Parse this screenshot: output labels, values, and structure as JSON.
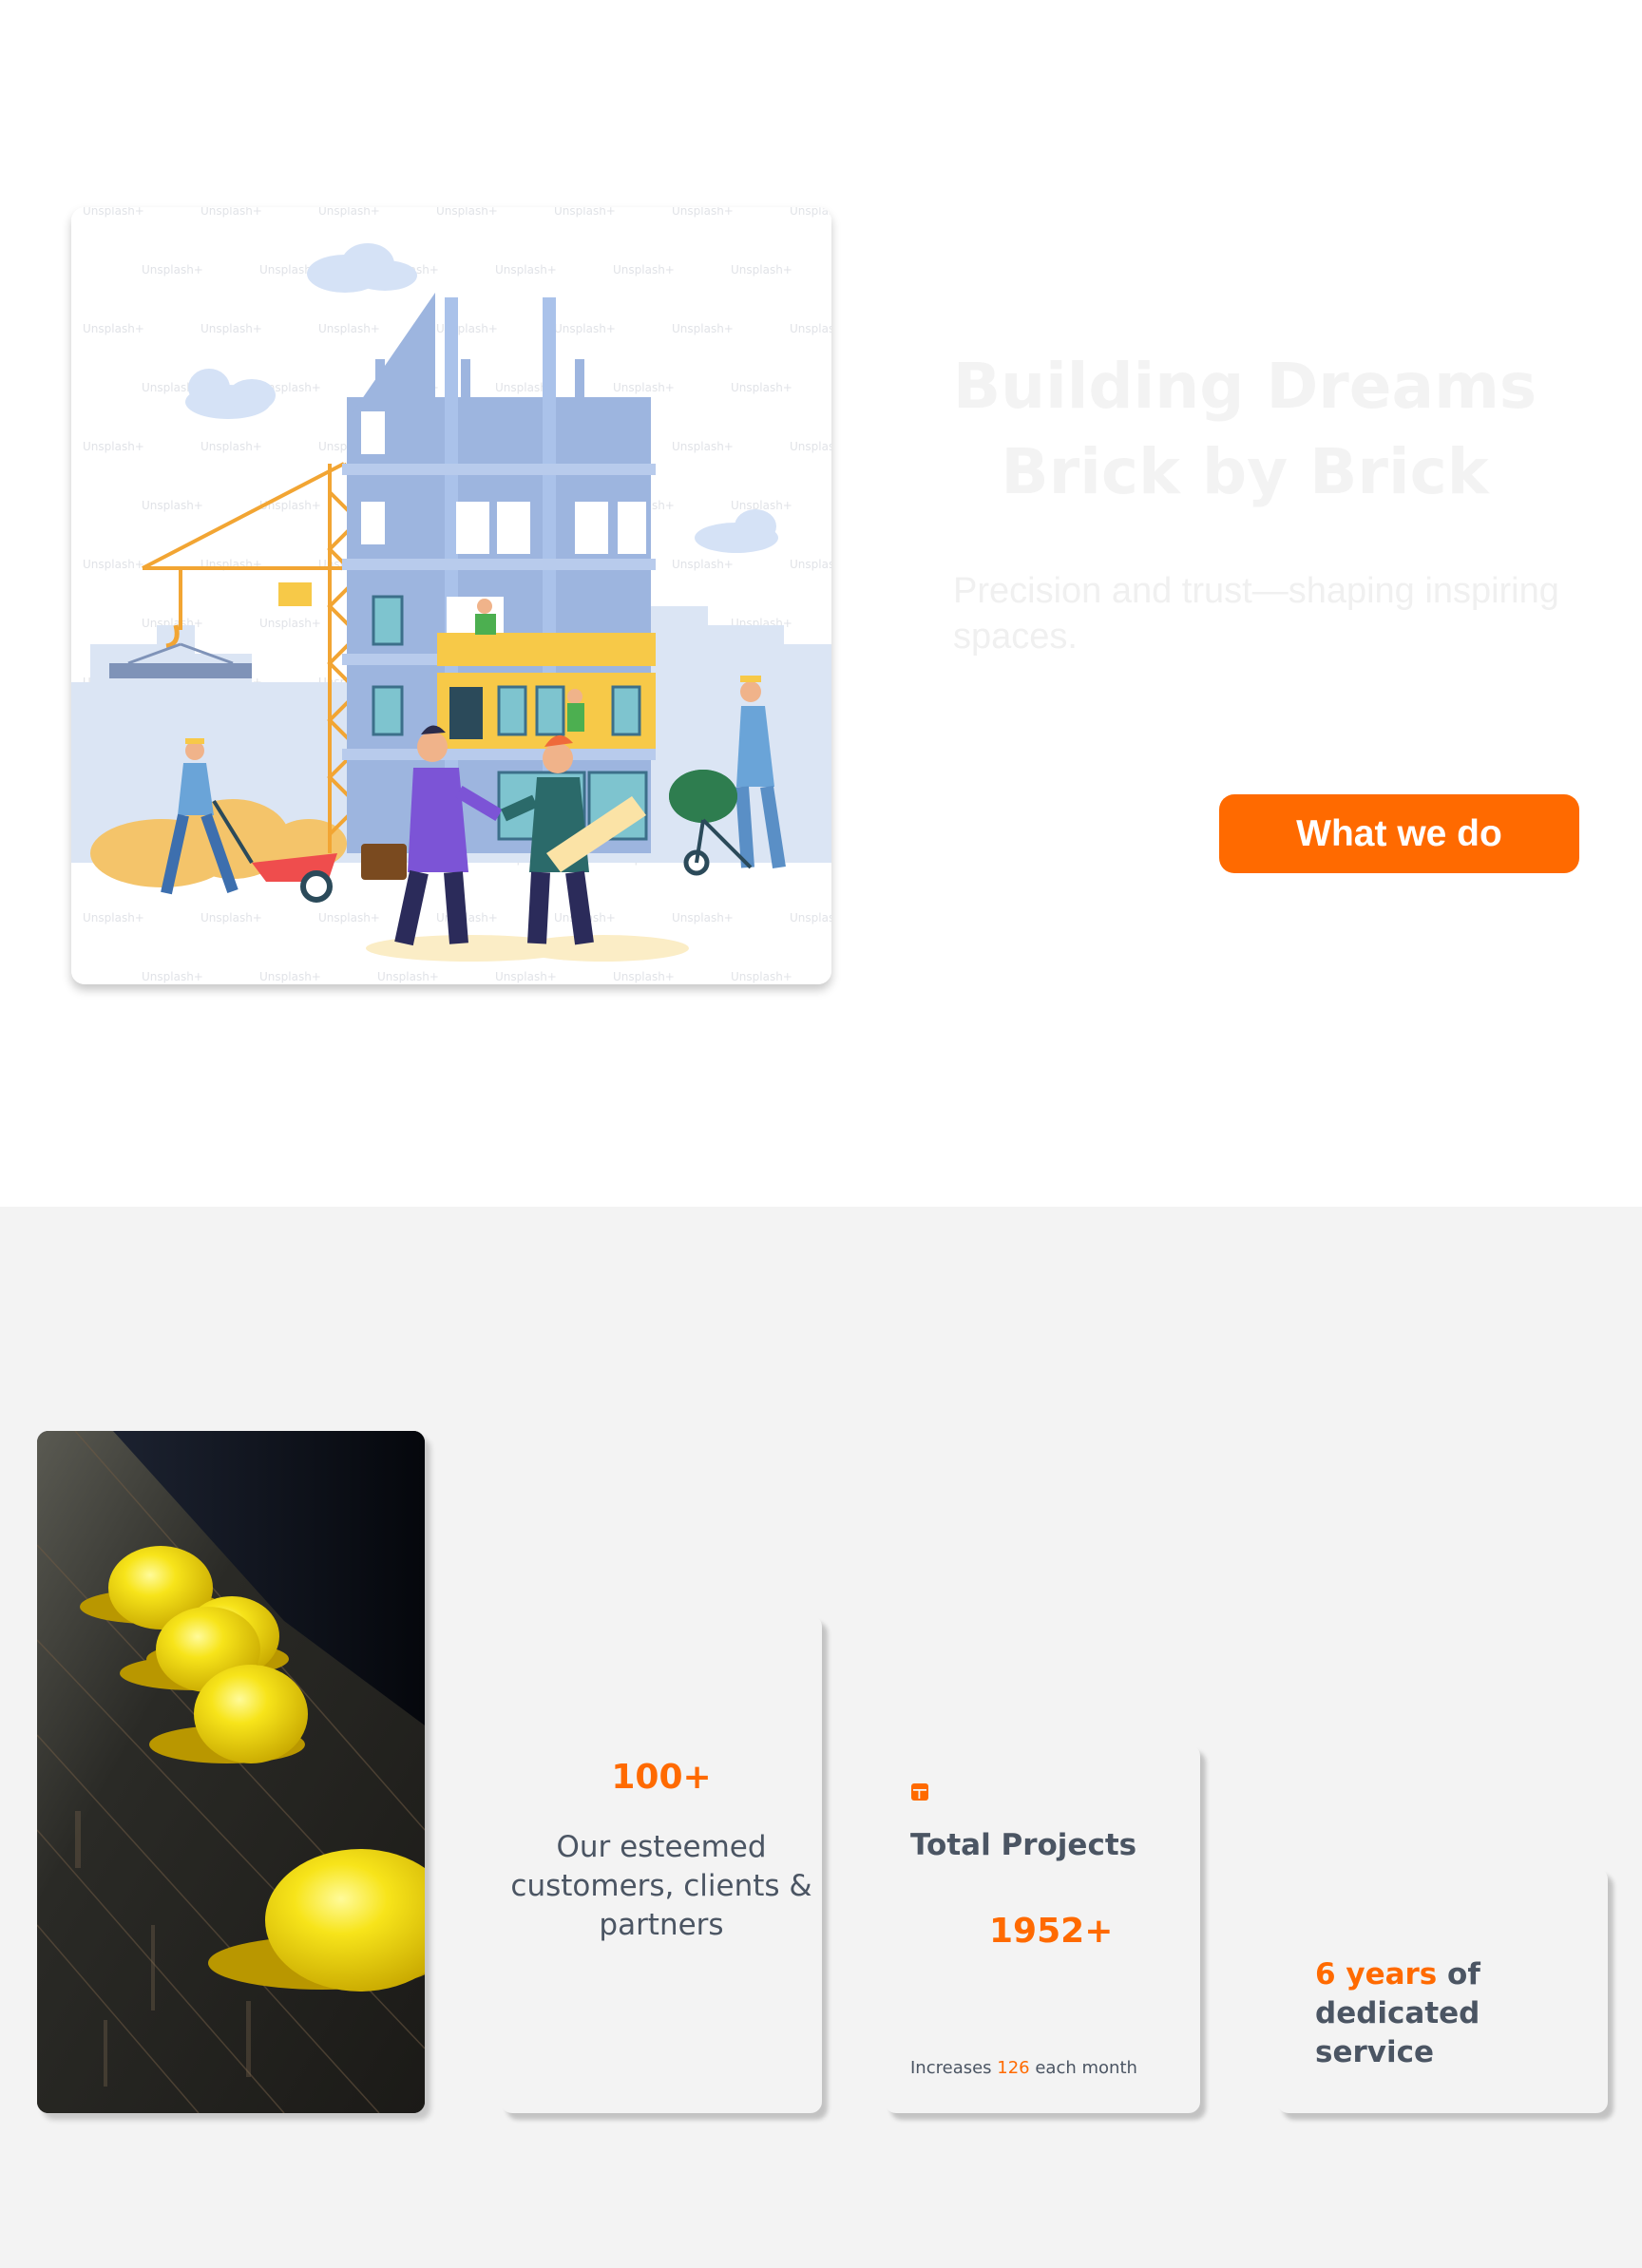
{
  "hero": {
    "title_line1": "Building Dreams",
    "title_line2": "Brick by Brick",
    "subtitle": "Precision and trust—shaping inspiring spaces.",
    "cta_label": "What we do",
    "watermark": "Unsplash+"
  },
  "stats": {
    "clients": {
      "value": "100+",
      "description": "Our esteemed customers, clients & partners"
    },
    "projects": {
      "icon": "layout-icon",
      "title": "Total Projects",
      "value": "1952+",
      "note_prefix": "Increases ",
      "note_value": "126",
      "note_suffix": " each month"
    },
    "experience": {
      "highlight": "6 years",
      "rest_1": " of",
      "rest_2": "dedicated service"
    }
  },
  "colors": {
    "accent": "#ff6a00",
    "text_muted": "#4b5563",
    "section_bg": "#f3f3f3"
  }
}
